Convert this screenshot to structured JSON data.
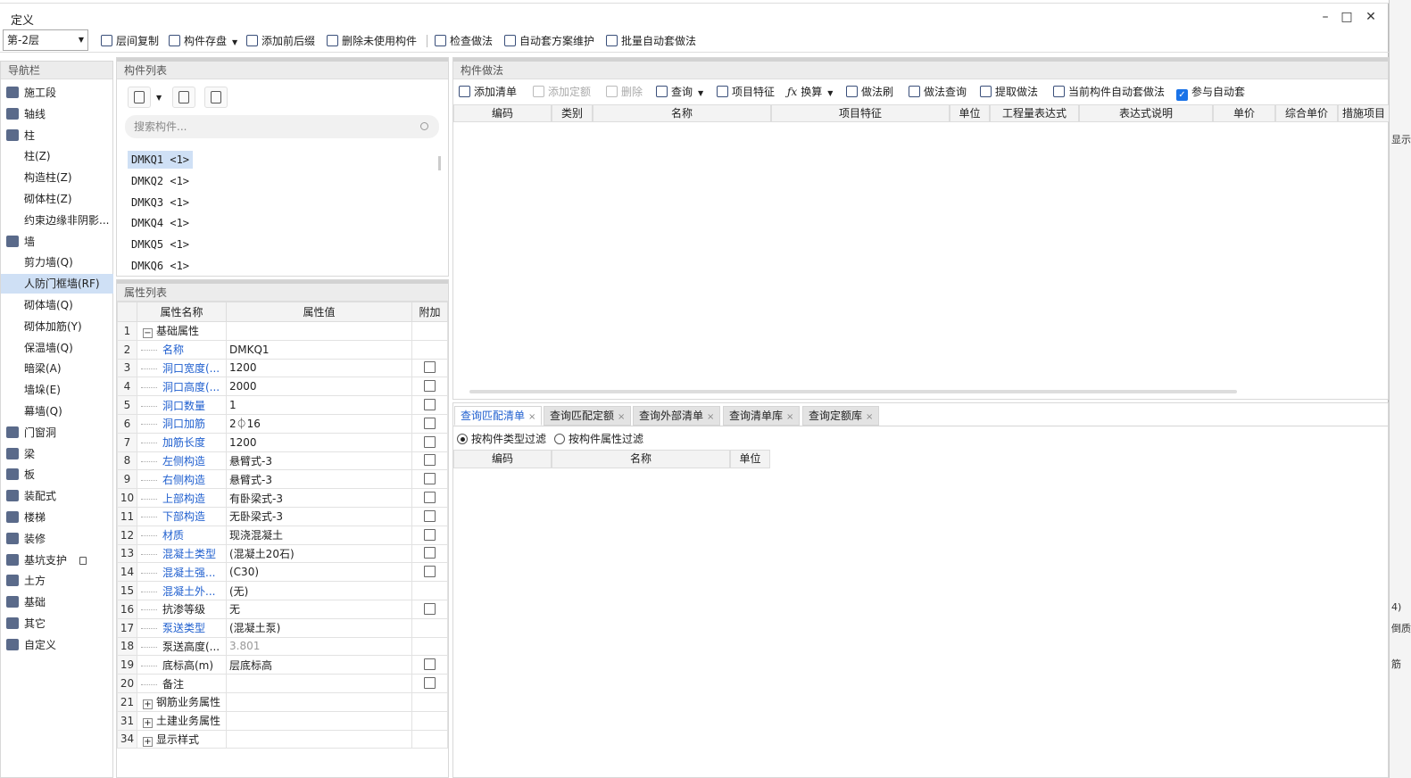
{
  "window": {
    "title": "定义",
    "controls": {
      "minimize": "–",
      "maximize": "□",
      "close": "✕"
    }
  },
  "toolbar": {
    "floor": "第-2层",
    "buttons": [
      "层间复制",
      "构件存盘",
      "添加前后缀",
      "删除未使用构件",
      "检查做法",
      "自动套方案维护",
      "批量自动套做法"
    ]
  },
  "nav": {
    "title": "导航栏",
    "items": [
      {
        "label": "施工段",
        "level": 0
      },
      {
        "label": "轴线",
        "level": 0
      },
      {
        "label": "柱",
        "level": 0
      },
      {
        "label": "柱(Z)",
        "level": 1
      },
      {
        "label": "构造柱(Z)",
        "level": 1
      },
      {
        "label": "砌体柱(Z)",
        "level": 1
      },
      {
        "label": "约束边缘非阴影...",
        "level": 1
      },
      {
        "label": "墙",
        "level": 0
      },
      {
        "label": "剪力墙(Q)",
        "level": 1
      },
      {
        "label": "人防门框墙(RF)",
        "level": 1,
        "selected": true
      },
      {
        "label": "砌体墙(Q)",
        "level": 1
      },
      {
        "label": "砌体加筋(Y)",
        "level": 1
      },
      {
        "label": "保温墙(Q)",
        "level": 1
      },
      {
        "label": "暗梁(A)",
        "level": 1
      },
      {
        "label": "墙垛(E)",
        "level": 1
      },
      {
        "label": "幕墙(Q)",
        "level": 1
      },
      {
        "label": "门窗洞",
        "level": 0
      },
      {
        "label": "梁",
        "level": 0
      },
      {
        "label": "板",
        "level": 0
      },
      {
        "label": "装配式",
        "level": 0
      },
      {
        "label": "楼梯",
        "level": 0
      },
      {
        "label": "装修",
        "level": 0
      },
      {
        "label": "基坑支护",
        "level": 0
      },
      {
        "label": "土方",
        "level": 0
      },
      {
        "label": "基础",
        "level": 0
      },
      {
        "label": "其它",
        "level": 0
      },
      {
        "label": "自定义",
        "level": 0
      }
    ]
  },
  "components": {
    "title": "构件列表",
    "search_placeholder": "搜索构件...",
    "items": [
      "DMKQ1 <1>",
      "DMKQ2 <1>",
      "DMKQ3 <1>",
      "DMKQ4 <1>",
      "DMKQ5 <1>",
      "DMKQ6 <1>"
    ]
  },
  "properties": {
    "title": "属性列表",
    "headers": {
      "name": "属性名称",
      "value": "属性值",
      "extra": "附加"
    },
    "rows": [
      {
        "num": "1",
        "name": "基础属性",
        "value": "",
        "kind": "group",
        "sign": "−",
        "check": false
      },
      {
        "num": "2",
        "name": "名称",
        "value": "DMKQ1",
        "kind": "blue",
        "check": false
      },
      {
        "num": "3",
        "name": "洞口宽度(...",
        "value": "1200",
        "kind": "blue",
        "check": true
      },
      {
        "num": "4",
        "name": "洞口高度(...",
        "value": "2000",
        "kind": "blue",
        "check": true
      },
      {
        "num": "5",
        "name": "洞口数量",
        "value": "1",
        "kind": "blue",
        "check": true
      },
      {
        "num": "6",
        "name": "洞口加筋",
        "value": "2⏀16",
        "kind": "blue",
        "check": true
      },
      {
        "num": "7",
        "name": "加筋长度",
        "value": "1200",
        "kind": "blue",
        "check": true
      },
      {
        "num": "8",
        "name": "左侧构造",
        "value": "悬臂式-3",
        "kind": "blue",
        "check": true
      },
      {
        "num": "9",
        "name": "右侧构造",
        "value": "悬臂式-3",
        "kind": "blue",
        "check": true
      },
      {
        "num": "10",
        "name": "上部构造",
        "value": "有卧梁式-3",
        "kind": "blue",
        "check": true
      },
      {
        "num": "11",
        "name": "下部构造",
        "value": "无卧梁式-3",
        "kind": "blue",
        "check": true
      },
      {
        "num": "12",
        "name": "材质",
        "value": "现浇混凝土",
        "kind": "blue",
        "check": true
      },
      {
        "num": "13",
        "name": "混凝土类型",
        "value": "(混凝土20石)",
        "kind": "blue",
        "check": true
      },
      {
        "num": "14",
        "name": "混凝土强...",
        "value": "(C30)",
        "kind": "blue",
        "check": true
      },
      {
        "num": "15",
        "name": "混凝土外...",
        "value": "(无)",
        "kind": "blue",
        "check": false
      },
      {
        "num": "16",
        "name": "抗渗等级",
        "value": "无",
        "kind": "plain",
        "check": true
      },
      {
        "num": "17",
        "name": "泵送类型",
        "value": "(混凝土泵)",
        "kind": "blue",
        "check": false
      },
      {
        "num": "18",
        "name": "泵送高度(...",
        "value": "3.801",
        "kind": "plain",
        "gray": true,
        "check": false
      },
      {
        "num": "19",
        "name": "底标高(m)",
        "value": "层底标高",
        "kind": "plain",
        "check": true
      },
      {
        "num": "20",
        "name": "备注",
        "value": "",
        "kind": "plain",
        "check": true
      },
      {
        "num": "21",
        "name": "钢筋业务属性",
        "value": "",
        "kind": "group",
        "sign": "+",
        "check": false
      },
      {
        "num": "31",
        "name": "土建业务属性",
        "value": "",
        "kind": "group",
        "sign": "+",
        "check": false
      },
      {
        "num": "34",
        "name": "显示样式",
        "value": "",
        "kind": "group",
        "sign": "+",
        "check": false
      }
    ]
  },
  "method": {
    "title": "构件做法",
    "toolbar": [
      "添加清单",
      "添加定额",
      "删除",
      "查询",
      "项目特征",
      "换算",
      "做法刷",
      "做法查询",
      "提取做法",
      "当前构件自动套做法"
    ],
    "auto_checkbox": "参与自动套",
    "headers": [
      "编码",
      "类别",
      "名称",
      "项目特征",
      "单位",
      "工程量表达式",
      "表达式说明",
      "单价",
      "综合单价",
      "措施项目"
    ]
  },
  "bottom": {
    "tabs": [
      "查询匹配清单",
      "查询匹配定额",
      "查询外部清单",
      "查询清单库",
      "查询定额库"
    ],
    "filters": [
      "按构件类型过滤",
      "按构件属性过滤"
    ],
    "headers": [
      "编码",
      "名称",
      "单位"
    ]
  },
  "right_strip": [
    "显示",
    "4)",
    "倒质",
    "筋"
  ]
}
